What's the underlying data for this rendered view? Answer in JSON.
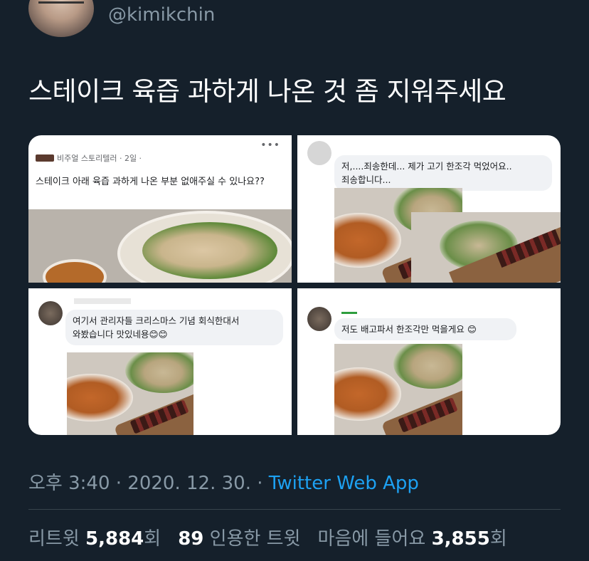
{
  "author": {
    "handle": "@kimikchin"
  },
  "tweet": {
    "text": "스테이크 육즙 과하게 나온 것 좀 지워주세요"
  },
  "media": {
    "panel1": {
      "meta": "비주얼 스토리텔러 · 2일 ·",
      "more": "•••",
      "text": "스테이크 아래 육즙 과하게 나온 부분 없애주실 수 있나요??"
    },
    "panel2": {
      "comment_line1": "저,....죄송한데... 제가 고기 한조각 먹었어요..",
      "comment_line2": "죄송합니다..."
    },
    "panel3": {
      "comment_line1": "여기서 관리자들 크리스마스 기념 회식한대서",
      "comment_line2": "와봤습니다 맛있네용😊😊"
    },
    "panel4": {
      "comment_line1": "저도 배고파서 한조각만 먹을게요 😊"
    }
  },
  "meta": {
    "time": "오후 3:40",
    "sep1": " · ",
    "date": "2020. 12. 30.",
    "sep2": " · ",
    "app": "Twitter Web App"
  },
  "stats": {
    "retweet_label": "리트윗",
    "retweet_count": "5,884",
    "retweet_suffix": "회",
    "quote_count": "89",
    "quote_label": "인용한 트윗",
    "like_label": "마음에 들어요",
    "like_count": "3,855",
    "like_suffix": "회"
  }
}
